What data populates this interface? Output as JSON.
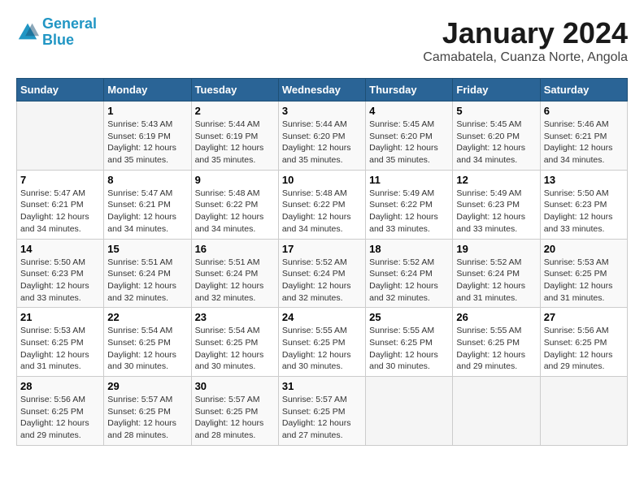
{
  "header": {
    "logo_line1": "General",
    "logo_line2": "Blue",
    "title": "January 2024",
    "subtitle": "Camabatela, Cuanza Norte, Angola"
  },
  "days_of_week": [
    "Sunday",
    "Monday",
    "Tuesday",
    "Wednesday",
    "Thursday",
    "Friday",
    "Saturday"
  ],
  "weeks": [
    [
      {
        "day": "",
        "info": ""
      },
      {
        "day": "1",
        "info": "Sunrise: 5:43 AM\nSunset: 6:19 PM\nDaylight: 12 hours\nand 35 minutes."
      },
      {
        "day": "2",
        "info": "Sunrise: 5:44 AM\nSunset: 6:19 PM\nDaylight: 12 hours\nand 35 minutes."
      },
      {
        "day": "3",
        "info": "Sunrise: 5:44 AM\nSunset: 6:20 PM\nDaylight: 12 hours\nand 35 minutes."
      },
      {
        "day": "4",
        "info": "Sunrise: 5:45 AM\nSunset: 6:20 PM\nDaylight: 12 hours\nand 35 minutes."
      },
      {
        "day": "5",
        "info": "Sunrise: 5:45 AM\nSunset: 6:20 PM\nDaylight: 12 hours\nand 34 minutes."
      },
      {
        "day": "6",
        "info": "Sunrise: 5:46 AM\nSunset: 6:21 PM\nDaylight: 12 hours\nand 34 minutes."
      }
    ],
    [
      {
        "day": "7",
        "info": "Sunrise: 5:47 AM\nSunset: 6:21 PM\nDaylight: 12 hours\nand 34 minutes."
      },
      {
        "day": "8",
        "info": "Sunrise: 5:47 AM\nSunset: 6:21 PM\nDaylight: 12 hours\nand 34 minutes."
      },
      {
        "day": "9",
        "info": "Sunrise: 5:48 AM\nSunset: 6:22 PM\nDaylight: 12 hours\nand 34 minutes."
      },
      {
        "day": "10",
        "info": "Sunrise: 5:48 AM\nSunset: 6:22 PM\nDaylight: 12 hours\nand 34 minutes."
      },
      {
        "day": "11",
        "info": "Sunrise: 5:49 AM\nSunset: 6:22 PM\nDaylight: 12 hours\nand 33 minutes."
      },
      {
        "day": "12",
        "info": "Sunrise: 5:49 AM\nSunset: 6:23 PM\nDaylight: 12 hours\nand 33 minutes."
      },
      {
        "day": "13",
        "info": "Sunrise: 5:50 AM\nSunset: 6:23 PM\nDaylight: 12 hours\nand 33 minutes."
      }
    ],
    [
      {
        "day": "14",
        "info": "Sunrise: 5:50 AM\nSunset: 6:23 PM\nDaylight: 12 hours\nand 33 minutes."
      },
      {
        "day": "15",
        "info": "Sunrise: 5:51 AM\nSunset: 6:24 PM\nDaylight: 12 hours\nand 32 minutes."
      },
      {
        "day": "16",
        "info": "Sunrise: 5:51 AM\nSunset: 6:24 PM\nDaylight: 12 hours\nand 32 minutes."
      },
      {
        "day": "17",
        "info": "Sunrise: 5:52 AM\nSunset: 6:24 PM\nDaylight: 12 hours\nand 32 minutes."
      },
      {
        "day": "18",
        "info": "Sunrise: 5:52 AM\nSunset: 6:24 PM\nDaylight: 12 hours\nand 32 minutes."
      },
      {
        "day": "19",
        "info": "Sunrise: 5:52 AM\nSunset: 6:24 PM\nDaylight: 12 hours\nand 31 minutes."
      },
      {
        "day": "20",
        "info": "Sunrise: 5:53 AM\nSunset: 6:25 PM\nDaylight: 12 hours\nand 31 minutes."
      }
    ],
    [
      {
        "day": "21",
        "info": "Sunrise: 5:53 AM\nSunset: 6:25 PM\nDaylight: 12 hours\nand 31 minutes."
      },
      {
        "day": "22",
        "info": "Sunrise: 5:54 AM\nSunset: 6:25 PM\nDaylight: 12 hours\nand 30 minutes."
      },
      {
        "day": "23",
        "info": "Sunrise: 5:54 AM\nSunset: 6:25 PM\nDaylight: 12 hours\nand 30 minutes."
      },
      {
        "day": "24",
        "info": "Sunrise: 5:55 AM\nSunset: 6:25 PM\nDaylight: 12 hours\nand 30 minutes."
      },
      {
        "day": "25",
        "info": "Sunrise: 5:55 AM\nSunset: 6:25 PM\nDaylight: 12 hours\nand 30 minutes."
      },
      {
        "day": "26",
        "info": "Sunrise: 5:55 AM\nSunset: 6:25 PM\nDaylight: 12 hours\nand 29 minutes."
      },
      {
        "day": "27",
        "info": "Sunrise: 5:56 AM\nSunset: 6:25 PM\nDaylight: 12 hours\nand 29 minutes."
      }
    ],
    [
      {
        "day": "28",
        "info": "Sunrise: 5:56 AM\nSunset: 6:25 PM\nDaylight: 12 hours\nand 29 minutes."
      },
      {
        "day": "29",
        "info": "Sunrise: 5:57 AM\nSunset: 6:25 PM\nDaylight: 12 hours\nand 28 minutes."
      },
      {
        "day": "30",
        "info": "Sunrise: 5:57 AM\nSunset: 6:25 PM\nDaylight: 12 hours\nand 28 minutes."
      },
      {
        "day": "31",
        "info": "Sunrise: 5:57 AM\nSunset: 6:25 PM\nDaylight: 12 hours\nand 27 minutes."
      },
      {
        "day": "",
        "info": ""
      },
      {
        "day": "",
        "info": ""
      },
      {
        "day": "",
        "info": ""
      }
    ]
  ]
}
